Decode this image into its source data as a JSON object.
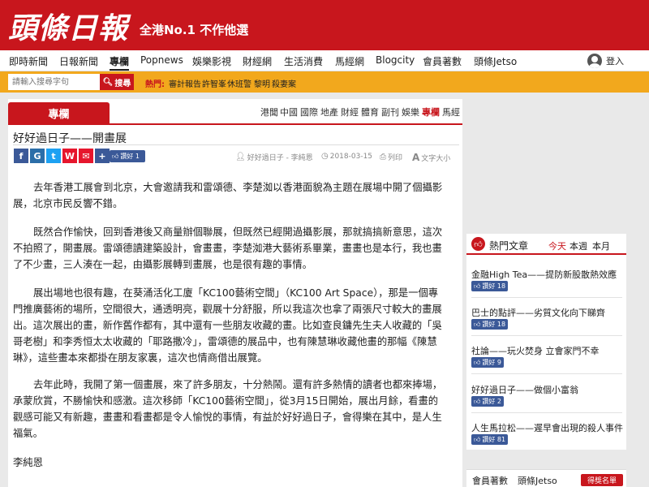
{
  "header": {
    "logo": "頭條日報",
    "slogan": "全港No.1 不作他選"
  },
  "nav": {
    "items": [
      "即時新聞",
      "日報新聞",
      "專欄",
      "Popnews",
      "娛樂影視",
      "財經網",
      "生活消費",
      "馬經網",
      "Blogcity",
      "會員著數",
      "頭條Jetso"
    ],
    "active": "專欄",
    "login": "登入"
  },
  "search": {
    "placeholder": "請輸入搜尋字句",
    "button": "搜尋",
    "hot_label": "熱門:",
    "hot_links": [
      "審計報告",
      "許智峯",
      "休班警",
      "黎明",
      "殺妻案"
    ]
  },
  "section": {
    "title": "專欄",
    "categories": [
      "港聞",
      "中國",
      "國際",
      "地產",
      "財經",
      "體育",
      "副刊",
      "娛樂",
      "專欄",
      "馬經"
    ],
    "active": "專欄"
  },
  "article": {
    "title": "好好過日子——開畫展",
    "like_label": "讚好 1",
    "meta_author": "好好過日子 - 李純恩",
    "meta_date": "2018-03-15",
    "meta_print": "列印",
    "meta_font": "文字大小",
    "paragraphs": [
      [
        "去年香港工展會到北京，大會邀請我和雷頌德、李楚洳以香港面貌為主題在展場中開了個攝影",
        "展，北京市民反響不錯。"
      ],
      [
        "既然合作愉快，回到香港後又商量辦個聯展，但既然已經開過攝影展，那就搞搞新意思，這次",
        "不拍照了，開畫展。雷頌德讀建築設計，會畫畫，李楚洳港大藝術系畢業，畫畫也是本行，我也畫",
        "了不少畫，三人湊在一起，由攝影展轉到畫展，也是很有趣的事情。"
      ],
      [
        "展出場地也很有趣，在葵涌活化工廈「KC100藝術空間」（KC100 Art Space），那是一個專",
        "門推廣藝術的場所，空間很大，通透明亮，觀展十分舒服，所以我這次也拿了兩張尺寸較大的畫展",
        "出。這次展出的畫，新作舊作都有，其中還有一些朋友收藏的畫。比如查良鏞先生夫人收藏的「吳",
        "哥老樹」和李秀恒太太收藏的「耶路撒冷」，雷頌德的展品中，也有陳慧琳收藏他畫的那幅《陳慧",
        "琳》，這些畫本來都掛在朋友家裏，這次也情商借出展覽。"
      ],
      [
        "去年此時，我開了第一個畫展，來了許多朋友，十分熱鬧。還有許多熱情的讀者也都來捧場，",
        "承蒙欣賞，不勝愉快和感激。這次移師「KC100藝術空間」，從3月15日開始，展出月餘，看畫的",
        "觀感可能又有新趣，畫畫和看畫都是令人愉悅的事情，有益於好好過日子，會得樂在其中，是人生",
        "福氣。"
      ]
    ],
    "author": "李純恩"
  },
  "hot": {
    "title": "熱門文章",
    "periods": [
      "今天",
      "本週",
      "本月"
    ],
    "active_period": "今天",
    "items": [
      {
        "title": "金融High Tea——提防新股散熱效應",
        "likes": "讚好 18"
      },
      {
        "title": "巴士的點評——劣質文化向下睇齊",
        "likes": "讚好 18"
      },
      {
        "title": "社論——玩火焚身 立會家門不幸",
        "likes": "讚好 9"
      },
      {
        "title": "好好過日子——做個小富翁",
        "likes": "讚好 2"
      },
      {
        "title": "人生馬拉松——遲早會出現的殺人事件",
        "likes": "讚好 81"
      }
    ]
  },
  "members": {
    "link1": "會員著數",
    "link2": "頭條Jetso",
    "button": "得獎名單"
  },
  "colors": {
    "brand_red": "#c8161d",
    "search_orange": "#f2a81d",
    "facebook_blue": "#3b5998"
  }
}
